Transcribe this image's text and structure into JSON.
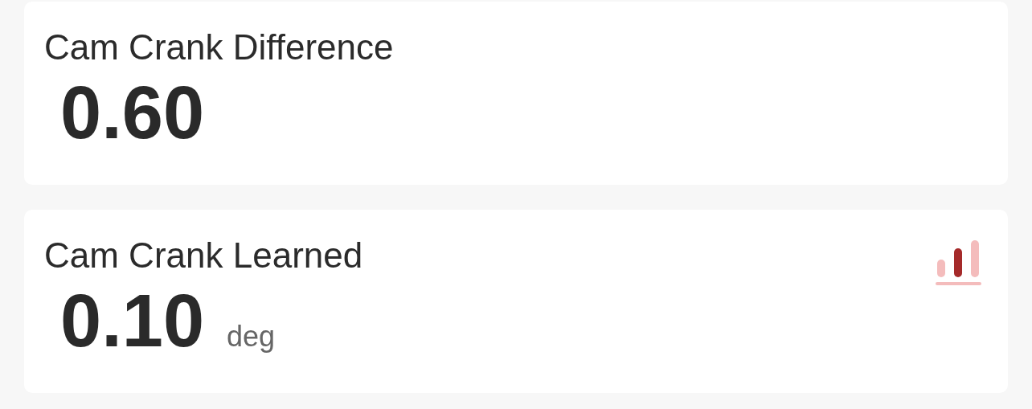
{
  "cards": [
    {
      "title": "Cam Crank Difference",
      "value": "0.60",
      "chart_icon": false
    },
    {
      "title": "Cam Crank Learned",
      "value": "0.10",
      "unit": "deg",
      "chart_icon": true
    }
  ]
}
